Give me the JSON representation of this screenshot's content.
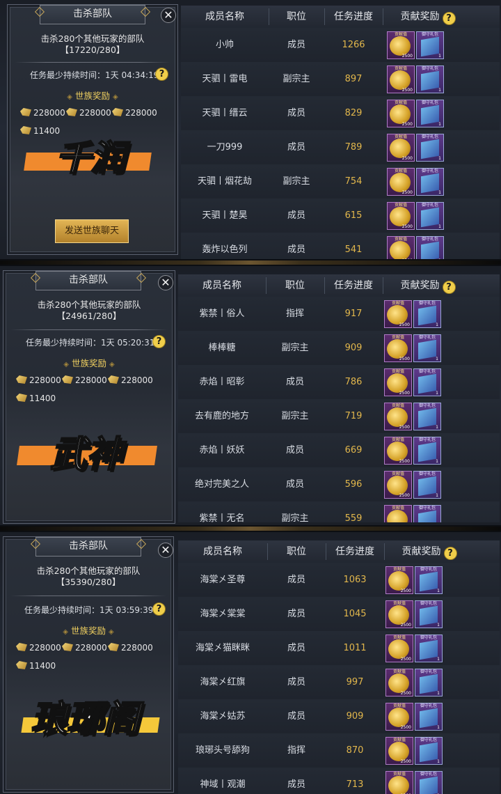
{
  "panels": [
    {
      "stamp": "千润",
      "title": "击杀部队",
      "close": "✕",
      "task_desc": "击杀280个其他玩家的部队",
      "task_count": "【17220/280】",
      "duration": "任务最少持续时间：1天 04:34:19",
      "reward_title": "世族奖励",
      "rewards": [
        "228000",
        "228000",
        "228000",
        "11400"
      ],
      "send_button": "发送世族聊天",
      "headers": [
        "成员名称",
        "职位",
        "任务进度",
        "贡献奖励"
      ],
      "rows": [
        {
          "name": "小帅",
          "role": "成员",
          "progress": "1266"
        },
        {
          "name": "天驷丨雷电",
          "role": "副宗主",
          "progress": "897"
        },
        {
          "name": "天驷丨缙云",
          "role": "成员",
          "progress": "829"
        },
        {
          "name": "一刀999",
          "role": "成员",
          "progress": "789"
        },
        {
          "name": "天驷丨烟花劫",
          "role": "副宗主",
          "progress": "754"
        },
        {
          "name": "天驷丨楚昊",
          "role": "成员",
          "progress": "615"
        },
        {
          "name": "轰炸以色列",
          "role": "成员",
          "progress": "541"
        }
      ]
    },
    {
      "stamp": "武神",
      "title": "击杀部队",
      "close": "✕",
      "task_desc": "击杀280个其他玩家的部队",
      "task_count": "【24961/280】",
      "duration": "任务最少持续时间：1天 05:20:31",
      "reward_title": "世族奖励",
      "rewards": [
        "228000",
        "228000",
        "228000",
        "11400"
      ],
      "send_button": "",
      "headers": [
        "成员名称",
        "职位",
        "任务进度",
        "贡献奖励"
      ],
      "rows": [
        {
          "name": "紫禁丨俗人",
          "role": "指挥",
          "progress": "917"
        },
        {
          "name": "棒棒糖",
          "role": "副宗主",
          "progress": "909"
        },
        {
          "name": "赤焰丨昭彰",
          "role": "成员",
          "progress": "786"
        },
        {
          "name": "去有鹿的地方",
          "role": "副宗主",
          "progress": "719"
        },
        {
          "name": "赤焰丨妖妖",
          "role": "成员",
          "progress": "669"
        },
        {
          "name": "绝对完美之人",
          "role": "成员",
          "progress": "596"
        },
        {
          "name": "紫禁丨无名",
          "role": "副宗主",
          "progress": "559"
        }
      ]
    },
    {
      "stamp": "琅琊阁",
      "title": "击杀部队",
      "close": "✕",
      "task_desc": "击杀280个其他玩家的部队",
      "task_count": "【35390/280】",
      "duration": "任务最少持续时间：1天 03:59:39",
      "reward_title": "世族奖励",
      "rewards": [
        "228000",
        "228000",
        "228000",
        "11400"
      ],
      "send_button": "",
      "headers": [
        "成员名称",
        "职位",
        "任务进度",
        "贡献奖励"
      ],
      "rows": [
        {
          "name": "海棠㐅圣尊",
          "role": "成员",
          "progress": "1063"
        },
        {
          "name": "海棠㐅棠棠",
          "role": "成员",
          "progress": "1045"
        },
        {
          "name": "海棠㐅猫眯眯",
          "role": "成员",
          "progress": "1011"
        },
        {
          "name": "海棠㐅红旗",
          "role": "成员",
          "progress": "997"
        },
        {
          "name": "海棠㐅姑苏",
          "role": "成员",
          "progress": "909"
        },
        {
          "name": "琅琊头号舔狗",
          "role": "指挥",
          "progress": "870"
        },
        {
          "name": "神域丨观潮",
          "role": "成员",
          "progress": "713"
        }
      ]
    }
  ],
  "reward_item": {
    "coin_label": "贡献值",
    "coin_qty": "2500",
    "pack_label": "御守礼包",
    "pack_qty": "1"
  },
  "colors": {
    "stamp_orange": "#f08a2e",
    "stamp_yellow": "#f5c83a",
    "progress_gold": "#e2b74c",
    "reward_title": "#f0d060"
  }
}
